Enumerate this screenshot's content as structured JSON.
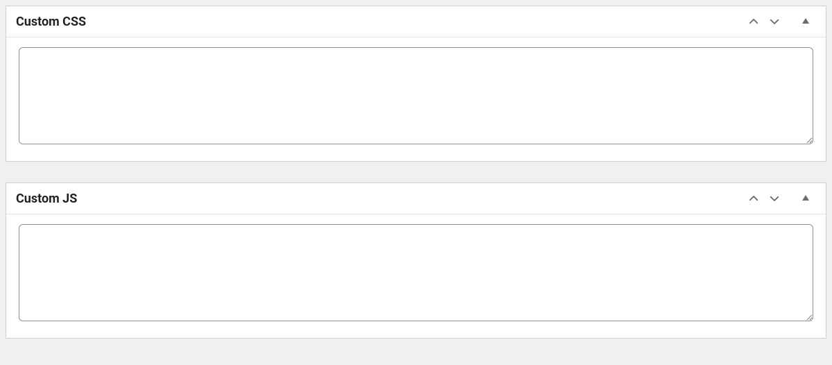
{
  "panels": [
    {
      "title": "Custom CSS",
      "value": ""
    },
    {
      "title": "Custom JS",
      "value": ""
    }
  ]
}
